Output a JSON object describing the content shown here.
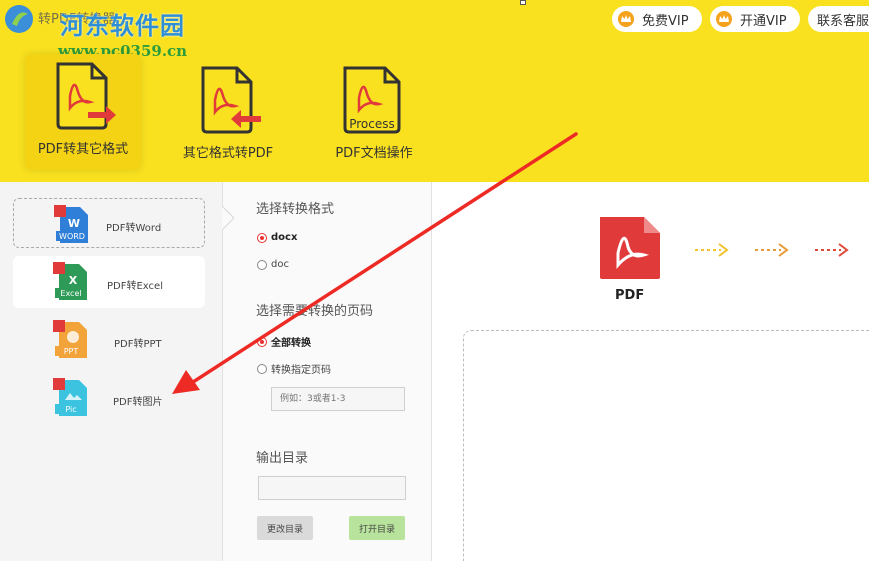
{
  "app": {
    "title": "转PDF转换器",
    "watermark_name": "河东软件园",
    "watermark_url": "www.pc0359.cn"
  },
  "header": {
    "free_vip": "免费VIP",
    "open_vip": "开通VIP",
    "support": "联系客服",
    "tabs": [
      {
        "label": "PDF转其它格式",
        "selected": true
      },
      {
        "label": "其它格式转PDF",
        "selected": false
      },
      {
        "label": "PDF文档操作",
        "selected": false
      }
    ],
    "process_label": "Process"
  },
  "sidebar": {
    "items": [
      {
        "label": "PDF转Word",
        "badge": "WORD"
      },
      {
        "label": "PDF转Excel",
        "badge": "Excel"
      },
      {
        "label": "PDF转PPT",
        "badge": "PPT"
      },
      {
        "label": "PDF转图片",
        "badge": "Pic"
      }
    ]
  },
  "options": {
    "format_heading": "选择转换格式",
    "format_docx": "docx",
    "format_doc": "doc",
    "pages_heading": "选择需要转换的页码",
    "pages_all": "全部转换",
    "pages_specific": "转换指定页码",
    "pages_placeholder": "例如：3或者1-3",
    "output_heading": "输出目录",
    "output_value": "",
    "change_dir": "更改目录",
    "open_dir": "打开目录"
  },
  "main": {
    "pdf_label": "PDF"
  },
  "colors": {
    "header_yellow": "#f9e11f",
    "pdf_red": "#e03a3a",
    "arrow_red": "#ee2a24"
  }
}
